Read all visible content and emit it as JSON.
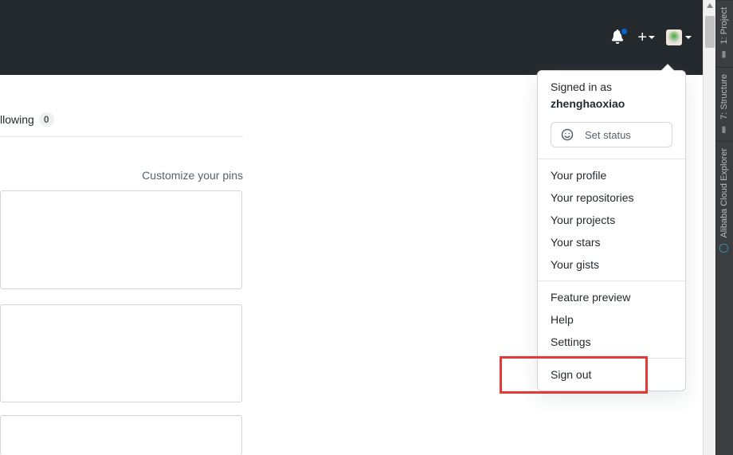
{
  "header": {
    "icons": {
      "notifications": "bell-icon",
      "create": "plus-icon",
      "avatar": "avatar"
    }
  },
  "profile": {
    "tab_following_label": "llowing",
    "following_count": "0",
    "customize_pins": "Customize your pins"
  },
  "menu": {
    "signed_in_label": "Signed in as",
    "username": "zhenghaoxiao",
    "set_status": "Set status",
    "group1": [
      "Your profile",
      "Your repositories",
      "Your projects",
      "Your stars",
      "Your gists"
    ],
    "group2": [
      "Feature preview",
      "Help",
      "Settings"
    ],
    "sign_out": "Sign out"
  },
  "ide_tabs": {
    "project": "1: Project",
    "structure": "7: Structure",
    "cloud": "Alibaba Cloud Explorer"
  }
}
